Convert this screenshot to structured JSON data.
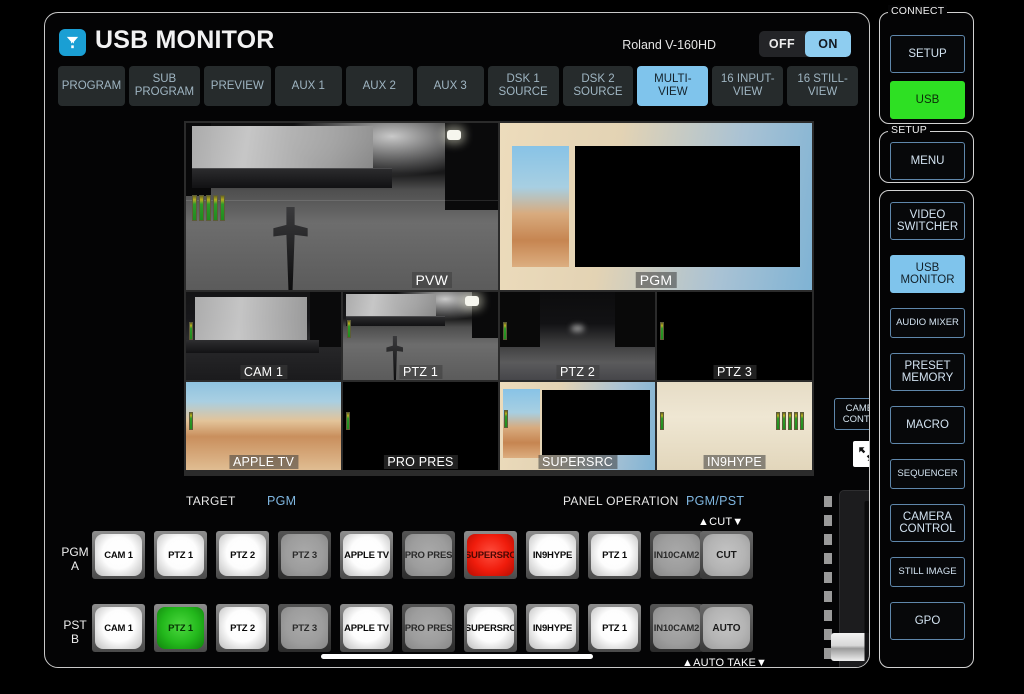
{
  "app": {
    "title": "USB MONITOR",
    "logo_icon": "usb-upload-icon",
    "device_name": "Roland V-160HD",
    "power_toggle": {
      "off_label": "OFF",
      "on_label": "ON",
      "state": "ON"
    }
  },
  "tabs": [
    {
      "label": "PROGRAM",
      "active": false
    },
    {
      "label": "SUB\nPROGRAM",
      "active": false
    },
    {
      "label": "PREVIEW",
      "active": false
    },
    {
      "label": "AUX 1",
      "active": false
    },
    {
      "label": "AUX 2",
      "active": false
    },
    {
      "label": "AUX 3",
      "active": false
    },
    {
      "label": "DSK 1\nSOURCE",
      "active": false
    },
    {
      "label": "DSK 2\nSOURCE",
      "active": false
    },
    {
      "label": "MULTI-\nVIEW",
      "active": true
    },
    {
      "label": "16 INPUT-\nVIEW",
      "active": false
    },
    {
      "label": "16 STILL-\nVIEW",
      "active": false
    }
  ],
  "multiview": {
    "row1": [
      {
        "label": "PVW",
        "border": "none",
        "meters": 5
      },
      {
        "label": "PGM",
        "border": "none",
        "meters": 0
      }
    ],
    "row2": [
      {
        "label": "CAM 1",
        "border": "none",
        "meters": 1
      },
      {
        "label": "PTZ 1",
        "border": "green",
        "meters": 1
      },
      {
        "label": "PTZ 2",
        "border": "none",
        "meters": 1
      },
      {
        "label": "PTZ 3",
        "border": "none",
        "meters": 1
      }
    ],
    "row3": [
      {
        "label": "APPLE TV",
        "border": "none",
        "meters": 1
      },
      {
        "label": "PRO PRES",
        "border": "none",
        "meters": 1
      },
      {
        "label": "SUPERSRC",
        "border": "red",
        "meters": 1
      },
      {
        "label": "IN9HYPE",
        "border": "none",
        "meters": 1
      }
    ]
  },
  "operation": {
    "target_label": "TARGET",
    "target_value": "PGM",
    "panel_operation_label": "PANEL OPERATION",
    "panel_operation_value": "PGM/PST"
  },
  "bus": {
    "pgm_label": "PGM",
    "pgm_sub": "A",
    "pst_label": "PST",
    "pst_sub": "B",
    "pgm_buttons": [
      {
        "label": "CAM 1",
        "state": "white"
      },
      {
        "label": "PTZ 1",
        "state": "white"
      },
      {
        "label": "PTZ 2",
        "state": "white"
      },
      {
        "label": "PTZ 3",
        "state": "dim"
      },
      {
        "label": "APPLE TV",
        "state": "white"
      },
      {
        "label": "PRO PRES",
        "state": "dim"
      },
      {
        "label": "SUPERSRC",
        "state": "red"
      },
      {
        "label": "IN9HYPE",
        "state": "white"
      },
      {
        "label": "PTZ 1",
        "state": "white"
      },
      {
        "label": "IN10CAM2",
        "state": "dim"
      }
    ],
    "pst_buttons": [
      {
        "label": "CAM 1",
        "state": "white"
      },
      {
        "label": "PTZ 1",
        "state": "green"
      },
      {
        "label": "PTZ 2",
        "state": "white"
      },
      {
        "label": "PTZ 3",
        "state": "dim"
      },
      {
        "label": "APPLE TV",
        "state": "white"
      },
      {
        "label": "PRO PRES",
        "state": "dim"
      },
      {
        "label": "SUPERSRC",
        "state": "white"
      },
      {
        "label": "IN9HYPE",
        "state": "white"
      },
      {
        "label": "PTZ 1",
        "state": "white"
      },
      {
        "label": "IN10CAM2",
        "state": "dim"
      }
    ],
    "cut_caption": "▲CUT▼",
    "cut_label": "CUT",
    "auto_label": "AUTO",
    "auto_take_caption": "▲AUTO TAKE▼"
  },
  "camera_control": {
    "label_line1": "CAMERA",
    "label_line2": "CONTROL",
    "expand_icon": "expand-arrows-icon"
  },
  "rail": {
    "connect": {
      "title": "CONNECT",
      "buttons": [
        {
          "label": "SETUP",
          "state": "idle"
        },
        {
          "label": "USB",
          "state": "green"
        }
      ]
    },
    "setup": {
      "title": "SETUP",
      "buttons": [
        {
          "label": "MENU",
          "state": "idle"
        }
      ]
    },
    "modes": {
      "buttons": [
        {
          "label": "VIDEO\nSWITCHER",
          "state": "idle",
          "size": "normal"
        },
        {
          "label": "USB\nMONITOR",
          "state": "blue",
          "size": "normal"
        },
        {
          "label": "AUDIO MIXER",
          "state": "idle",
          "size": "small"
        },
        {
          "label": "PRESET\nMEMORY",
          "state": "idle",
          "size": "normal"
        },
        {
          "label": "MACRO",
          "state": "idle",
          "size": "normal"
        },
        {
          "label": "SEQUENCER",
          "state": "idle",
          "size": "small"
        },
        {
          "label": "CAMERA\nCONTROL",
          "state": "idle",
          "size": "normal"
        },
        {
          "label": "STILL IMAGE",
          "state": "idle",
          "size": "small"
        },
        {
          "label": "GPO",
          "state": "idle",
          "size": "normal"
        }
      ]
    }
  },
  "colors": {
    "accent_blue": "#7fc4ec",
    "active_green": "#2ee023",
    "program_red": "#f01c0c",
    "panel_bg": "#040405"
  }
}
